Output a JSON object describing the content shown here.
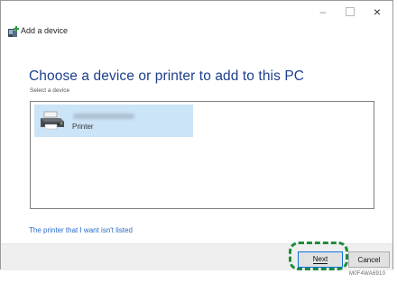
{
  "window": {
    "title": "Add a device",
    "controls": {
      "minimize": "–",
      "close": "×"
    }
  },
  "main": {
    "heading": "Choose a device or printer to add to this PC",
    "subheading": "Select a device",
    "devices": [
      {
        "type": "Printer",
        "icon": "printer-icon",
        "selected": true
      }
    ],
    "missing_link": "The printer that I want isn't listed"
  },
  "footer": {
    "next_label": "Next",
    "cancel_label": "Cancel"
  },
  "figure_code": "M0F4WA6910",
  "colors": {
    "heading": "#1d3f8f",
    "link": "#2a6bc7",
    "selection": "#cce4f7",
    "highlight": "#1e8a3c",
    "default_button_border": "#0a73d9"
  }
}
